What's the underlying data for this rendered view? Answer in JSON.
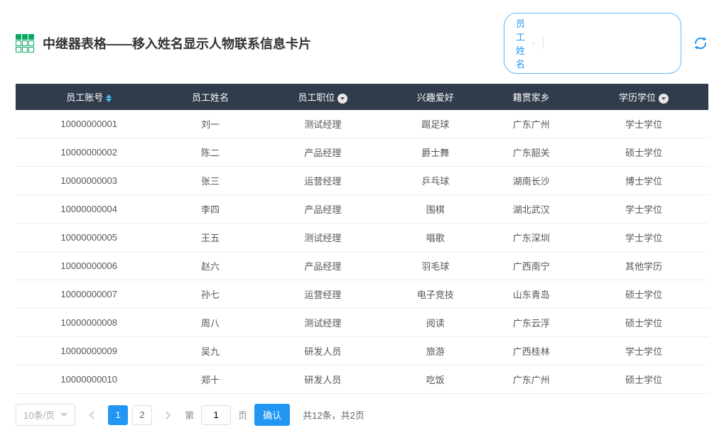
{
  "title": "中继器表格——移入姓名显示人物联系信息卡片",
  "search": {
    "selectLabel": "员工姓名",
    "placeholder": ""
  },
  "columns": [
    "员工账号",
    "员工姓名",
    "员工职位",
    "兴趣爱好",
    "籍贯家乡",
    "学历学位"
  ],
  "rows": [
    {
      "id": "10000000001",
      "name": "刘一",
      "pos": "测试经理",
      "hobby": "踢足球",
      "home": "广东广州",
      "edu": "学士学位"
    },
    {
      "id": "10000000002",
      "name": "陈二",
      "pos": "产品经理",
      "hobby": "爵士舞",
      "home": "广东韶关",
      "edu": "硕士学位"
    },
    {
      "id": "10000000003",
      "name": "张三",
      "pos": "运营经理",
      "hobby": "乒乓球",
      "home": "湖南长沙",
      "edu": "博士学位"
    },
    {
      "id": "10000000004",
      "name": "李四",
      "pos": "产品经理",
      "hobby": "围棋",
      "home": "湖北武汉",
      "edu": "学士学位"
    },
    {
      "id": "10000000005",
      "name": "王五",
      "pos": "测试经理",
      "hobby": "唱歌",
      "home": "广东深圳",
      "edu": "学士学位"
    },
    {
      "id": "10000000006",
      "name": "赵六",
      "pos": "产品经理",
      "hobby": "羽毛球",
      "home": "广西南宁",
      "edu": "其他学历"
    },
    {
      "id": "10000000007",
      "name": "孙七",
      "pos": "运营经理",
      "hobby": "电子竞技",
      "home": "山东青岛",
      "edu": "硕士学位"
    },
    {
      "id": "10000000008",
      "name": "周八",
      "pos": "测试经理",
      "hobby": "阅读",
      "home": "广东云浮",
      "edu": "硕士学位"
    },
    {
      "id": "10000000009",
      "name": "吴九",
      "pos": "研发人员",
      "hobby": "旅游",
      "home": "广西桂林",
      "edu": "学士学位"
    },
    {
      "id": "10000000010",
      "name": "郑十",
      "pos": "研发人员",
      "hobby": "吃饭",
      "home": "广东广州",
      "edu": "硕士学位"
    }
  ],
  "footer": {
    "perPage": "10条/页",
    "pages": [
      "1",
      "2"
    ],
    "activePage": 1,
    "prefix": "第",
    "suffix": "页",
    "currentInput": "1",
    "confirm": "确认",
    "info": "共12条，共2页"
  }
}
